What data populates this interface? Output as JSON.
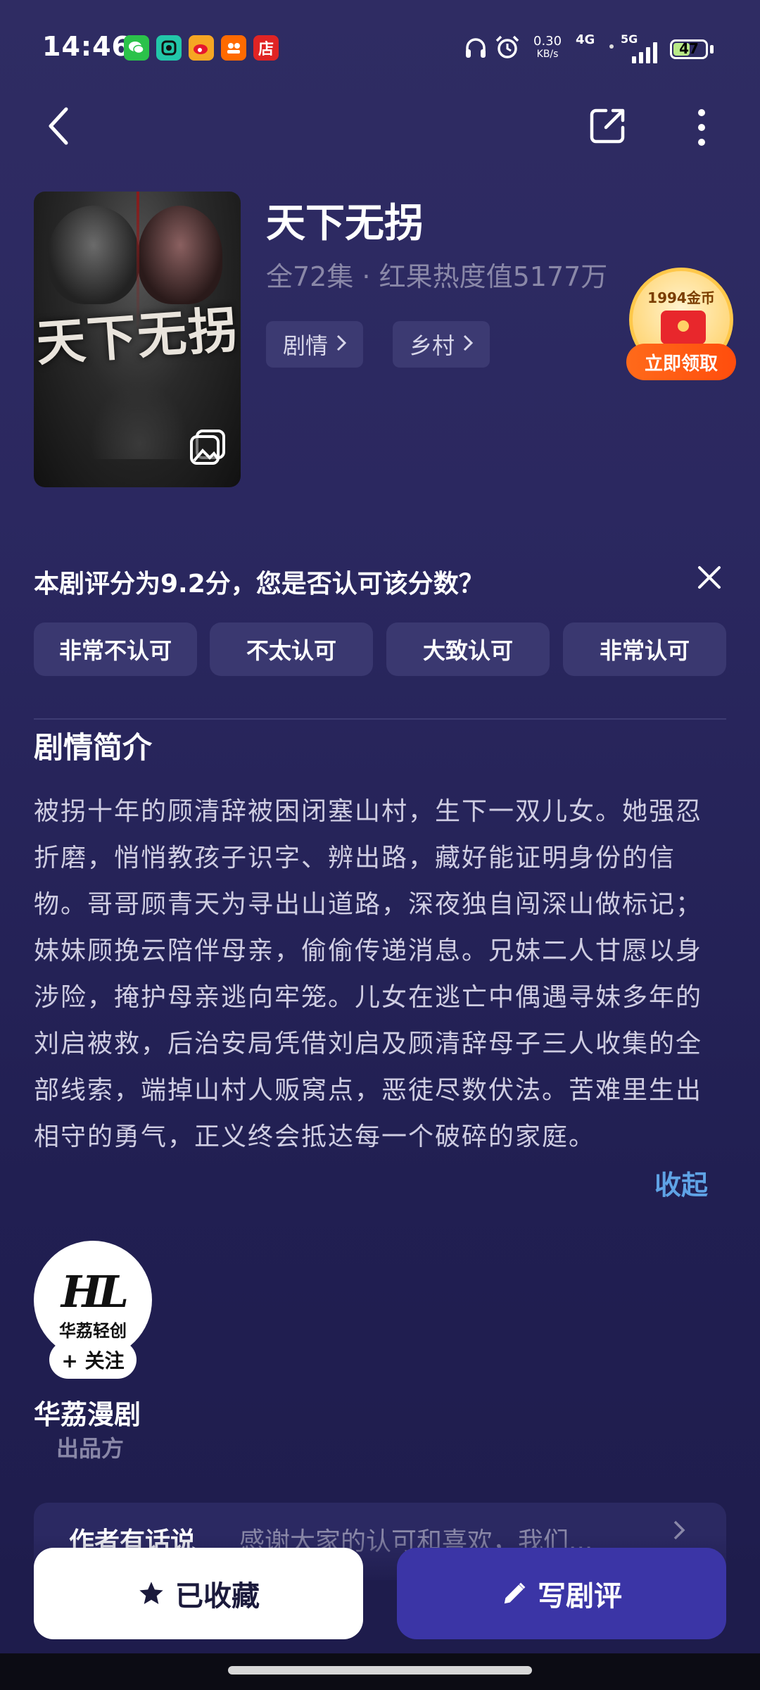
{
  "status_bar": {
    "time": "14:46",
    "apps": [
      {
        "icon": "wechat-icon",
        "color": "#2bc24a",
        "glyph": "W"
      },
      {
        "icon": "camera-app-icon",
        "color": "#22c7a9",
        "glyph": "◎"
      },
      {
        "icon": "weibo-icon",
        "color": "#f6a623",
        "glyph": "微"
      },
      {
        "icon": "taobao-icon",
        "color": "#ff6a00",
        "glyph": "淘"
      },
      {
        "icon": "store-icon",
        "color": "#e02424",
        "glyph": "店"
      }
    ],
    "net_speed_value": "0.30",
    "net_speed_unit": "KB/s",
    "network_4g": "4G",
    "network_5g": "5G",
    "battery": "47",
    "battery_level": 0.47
  },
  "drama": {
    "title": "天下无拐",
    "meta": "全72集 · 红果热度值5177万",
    "poster_title": "天下无拐",
    "tags": [
      "剧情",
      "乡村"
    ]
  },
  "reward": {
    "coins": "1994金币",
    "claim": "立即领取"
  },
  "rating": {
    "question": "本剧评分为9.2分，您是否认可该分数？",
    "options": [
      "非常不认可",
      "不太认可",
      "大致认可",
      "非常认可"
    ]
  },
  "synopsis": {
    "title": "剧情简介",
    "text": "被拐十年的顾清辞被困闭塞山村，生下一双儿女。她强忍折磨，悄悄教孩子识字、辨出路，藏好能证明身份的信物。哥哥顾青天为寻出山道路，深夜独自闯深山做标记；妹妹顾挽云陪伴母亲，偷偷传递消息。兄妹二人甘愿以身涉险，掩护母亲逃向牢笼。儿女在逃亡中偶遇寻妹多年的刘启被救，后治安局凭借刘启及顾清辞母子三人收集的全部线索，端掉山村人贩窝点，恶徒尽数伏法。苦难里生出相守的勇气，正义终会抵达每一个破碎的家庭。",
    "collapse": "收起"
  },
  "producer": {
    "logo": "HL",
    "logo_sub": "华荔轻创",
    "follow": "+ 关注",
    "name": "华荔漫剧",
    "role": "出品方"
  },
  "author_note": {
    "label": "作者有话说",
    "text": "感谢大家的认可和喜欢，我们..."
  },
  "actions": {
    "collected": "已收藏",
    "write_review": "写剧评"
  }
}
